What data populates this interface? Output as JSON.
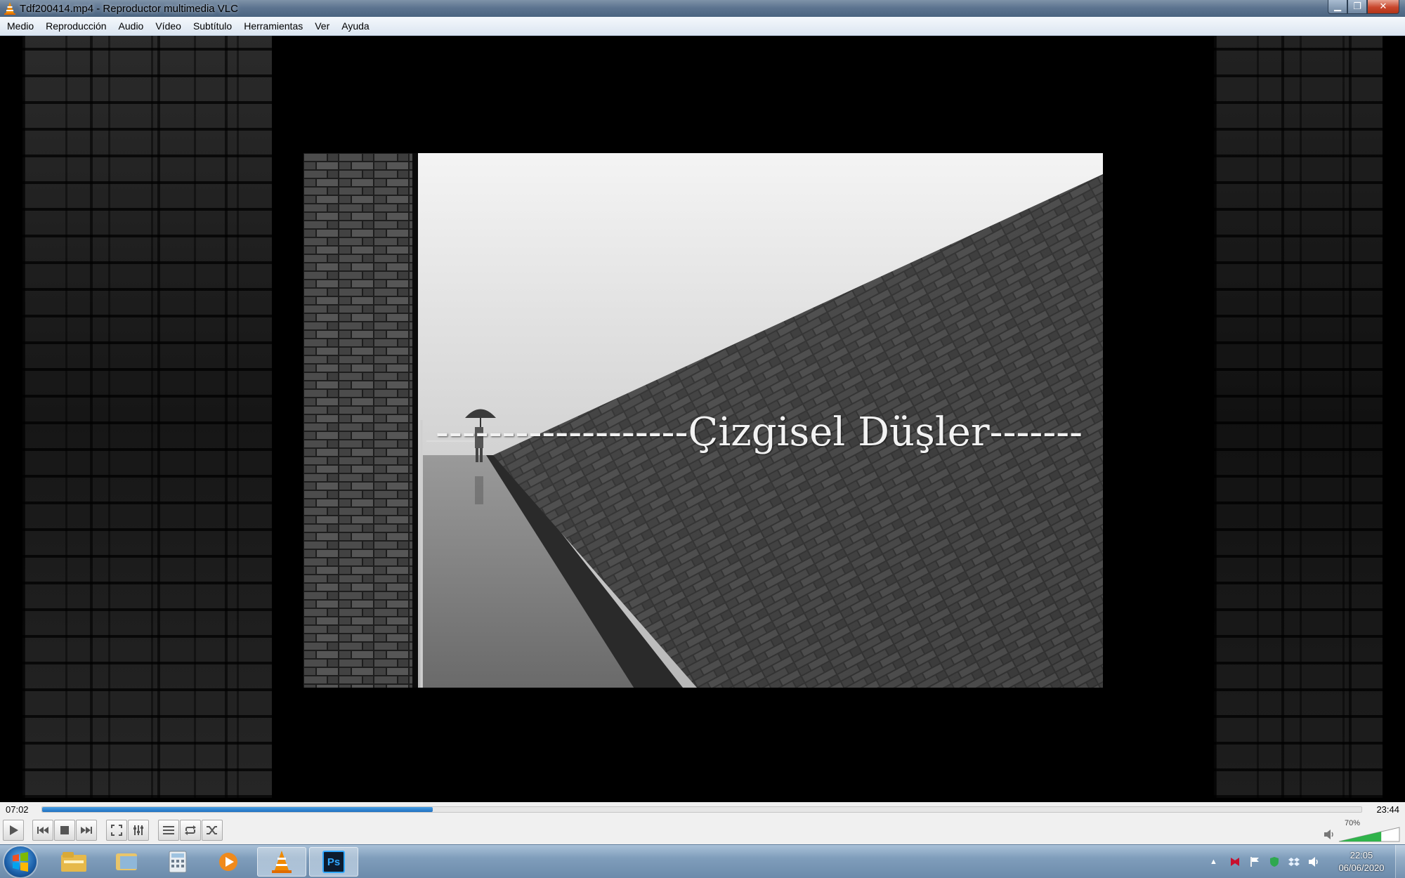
{
  "window": {
    "title": "Tdf200414.mp4 - Reproductor multimedia VLC"
  },
  "menu": [
    "Medio",
    "Reproducción",
    "Audio",
    "Vídeo",
    "Subtítulo",
    "Herramientas",
    "Ver",
    "Ayuda"
  ],
  "video": {
    "caption": "-------------------Çizgisel Düşler-------"
  },
  "playback": {
    "elapsed": "07:02",
    "total": "23:44",
    "progress_fraction": 0.296,
    "volume_label": "70%",
    "volume_fraction": 0.7
  },
  "taskbar": {
    "time": "22:05",
    "date": "06/06/2020",
    "items": [
      "explorer-icon",
      "libraries-icon",
      "calculator-icon",
      "media-player-icon",
      "vlc-icon",
      "photoshop-icon"
    ],
    "photoshop_label": "Ps"
  },
  "colors": {
    "seek_fill": "#1f6fc0",
    "volume_fill": "#2fb34a",
    "title_bar": "#5d7490"
  }
}
